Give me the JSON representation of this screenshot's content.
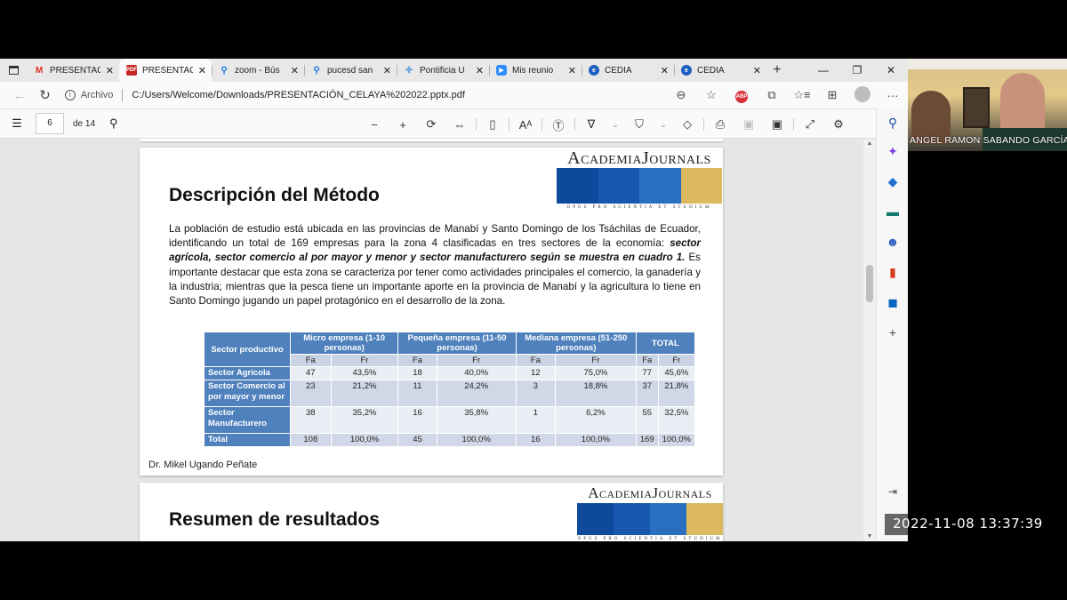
{
  "browser": {
    "tabs": [
      {
        "icon": "gmail-icon",
        "label": "PRESENTAC",
        "active": false
      },
      {
        "icon": "pdf-icon",
        "label": "PRESENTAC",
        "active": true
      },
      {
        "icon": "search-icon",
        "label": "zoom - Bús",
        "active": false
      },
      {
        "icon": "search-icon",
        "label": "pucesd san",
        "active": false
      },
      {
        "icon": "pontificia-icon",
        "label": "Pontificia U",
        "active": false
      },
      {
        "icon": "zoom-icon",
        "label": "Mis reunio",
        "active": false
      },
      {
        "icon": "cedia-icon",
        "label": "CEDIA",
        "active": false
      },
      {
        "icon": "cedia-icon",
        "label": "CEDIA",
        "active": false
      }
    ],
    "address": {
      "scheme_label": "Archivo",
      "url": "C:/Users/Welcome/Downloads/PRESENTACIÓN_CELAYA%202022.pptx.pdf"
    }
  },
  "pdf_toolbar": {
    "current_page": "6",
    "total_pages": "de 14"
  },
  "slide1": {
    "title": "Descripción del Método",
    "logo": {
      "name": "AcademiaJournals",
      "motto": "OPUS PRO SCIENTIA ET STUDIUM",
      "colors": [
        "#0e4a9c",
        "#1657b0",
        "#2a6ec0",
        "#dcb95e"
      ]
    },
    "paragraph_part1": "La población de estudio está ubicada en las provincias de Manabí y Santo Domingo de los Tsáchilas de Ecuador, identificando un total de 169 empresas para la zona 4 clasificadas en tres sectores de la economía: ",
    "paragraph_bold": "sector agrícola, sector comercio al por mayor y menor y sector manufacturero según se muestra en cuadro 1.",
    "paragraph_part2": " Es importante destacar que esta zona se caracteriza por tener como actividades principales el comercio, la ganadería y la industria; mientras que la pesca tiene un importante aporte en la provincia de Manabí y la agricultura lo tiene en Santo Domingo jugando un papel protagónico en el desarrollo de la zona.",
    "table": {
      "header_first": "Sector productivo",
      "groups": [
        "Micro empresa (1-10 personas)",
        "Pequeña empresa (11-50 personas)",
        "Mediana empresa (51-250 personas)",
        "TOTAL"
      ],
      "sub_headers": [
        "Fa",
        "Fr",
        "Fa",
        "Fr",
        "Fa",
        "Fr",
        "Fa",
        "Fr"
      ],
      "rows": [
        {
          "label": "Sector Agrícola",
          "values": [
            "47",
            "43,5%",
            "18",
            "40,0%",
            "12",
            "75,0%",
            "77",
            "45,6%"
          ]
        },
        {
          "label": "Sector Comercio al por mayor y menor",
          "values": [
            "23",
            "21,2%",
            "11",
            "24,2%",
            "3",
            "18,8%",
            "37",
            "21,8%"
          ]
        },
        {
          "label": "Sector Manufacturero",
          "values": [
            "38",
            "35,2%",
            "16",
            "35,8%",
            "1",
            "6,2%",
            "55",
            "32,5%"
          ]
        },
        {
          "label": "Total",
          "values": [
            "108",
            "100,0%",
            "45",
            "100,0%",
            "16",
            "100,0%",
            "169",
            "100,0%"
          ]
        }
      ]
    },
    "author": "Dr. Mikel Ugando Peñate"
  },
  "slide2": {
    "title": "Resumen de resultados"
  },
  "video": {
    "participant_name": "ANGEL RAMON SABANDO GARCÍA"
  },
  "overlay": {
    "timestamp": "2022-11-08 13:37:39"
  }
}
